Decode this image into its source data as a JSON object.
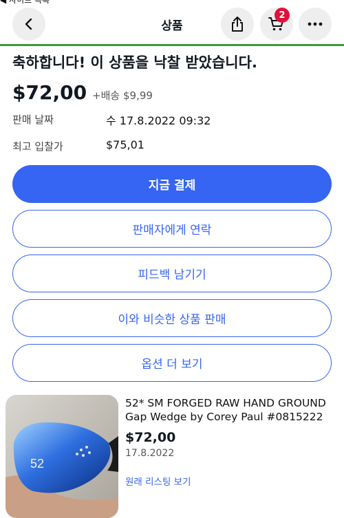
{
  "status_bar": {
    "back_app_label": "◀ 사이트 목록"
  },
  "nav": {
    "title": "상품",
    "cart_count": "2",
    "icons": {
      "back": "chevron-left-icon",
      "share": "share-icon",
      "cart": "cart-icon",
      "more": "more-icon"
    }
  },
  "banner": {
    "message": "축하합니다! 이 상품을 낙찰 받았습니다."
  },
  "price": {
    "amount": "$72,00",
    "shipping": "+배송 $9,99"
  },
  "details": [
    {
      "label": "판매 날짜",
      "value": "수 17.8.2022 09:32"
    },
    {
      "label": "최고 입찰가",
      "value": "$75,01"
    }
  ],
  "actions": {
    "pay": "지금 결제",
    "contact_seller": "판매자에게 연락",
    "leave_feedback": "피드백 남기기",
    "sell_similar": "이와 비슷한 상품 판매",
    "more_options": "옵션 더 보기"
  },
  "item": {
    "title": "52* SM FORGED RAW HAND GROUND Gap Wedge by Corey Paul #0815222",
    "price": "$72,00",
    "date": "17.8.2022",
    "view_listing": "원래 리스팅 보기",
    "image_stamp": "52"
  },
  "colors": {
    "accent": "#3665f3",
    "badge": "#e0103a",
    "divider": "#3a9a3a"
  }
}
